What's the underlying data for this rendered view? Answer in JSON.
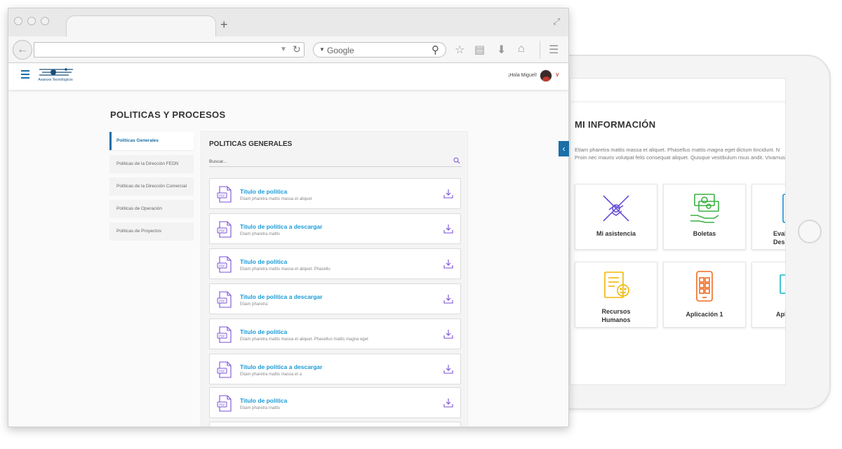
{
  "browser": {
    "new_tab_symbol": "+",
    "search_engine_label": "Google",
    "url_value": ""
  },
  "app": {
    "logo_text": "Avances Tecnológicos",
    "greeting": "¡Hola Miguel!",
    "page_title": "POLITICAS Y PROCESOS",
    "sidebar": {
      "items": [
        {
          "label": "Politicas Generales",
          "active": true
        },
        {
          "label": "Politicas de la Dirección FEDN",
          "active": false
        },
        {
          "label": "Politicas de la Dirección Comercial",
          "active": false
        },
        {
          "label": "Politicas de Operación",
          "active": false
        },
        {
          "label": "Politicas de Proyectos",
          "active": false
        }
      ]
    },
    "panel": {
      "title": "POLITICAS GENERALES",
      "search_placeholder": "Buscar...",
      "documents": [
        {
          "title": "Titulo de politica",
          "subtitle": "Etiam pharetra mattis massa et aliquet"
        },
        {
          "title": "Titulo de politica a descargar",
          "subtitle": "Etiam pharetra mattis"
        },
        {
          "title": "Titulo de politica",
          "subtitle": "Etiam pharetra mattis massa et aliquet. Phasellu"
        },
        {
          "title": "Titulo de politica a descargar",
          "subtitle": "Etiam pharetra"
        },
        {
          "title": "Titulo de politica",
          "subtitle": "Etiam pharetra mattis massa et aliquet. Phasellus mattis magna eget"
        },
        {
          "title": "Titulo de politica a descargar",
          "subtitle": "Etiam pharetra mattis massa et a"
        },
        {
          "title": "Titulo de politica",
          "subtitle": "Etiam pharetra mattis"
        }
      ]
    }
  },
  "tablet": {
    "title": "MI INFORMACIÓN",
    "description_line1": "Etiam pharetra mattis massa et aliquet. Phasellus mattis magna eget dictum tincidunt. N",
    "description_line2": "Proin nec mauris volutpat felis consequat aliquet. Quisque vestibulum risus andit. Vivamus",
    "cards": [
      {
        "label": "Mi asistencia",
        "icon": "handshake-icon",
        "color": "#6b4fd8"
      },
      {
        "label": "Boletas",
        "icon": "money-hand-icon",
        "color": "#3cb043"
      },
      {
        "label": "Evalu\nDes",
        "icon": "checklist-icon",
        "color": "#1a8fd8"
      },
      {
        "label": "Recursos\nHumanos",
        "icon": "document-smile-icon",
        "color": "#f2b705"
      },
      {
        "label": "Aplicación 1",
        "icon": "mobile-grid-icon",
        "color": "#f26a21"
      },
      {
        "label": "Apl",
        "icon": "monitor-check-icon",
        "color": "#13b5cf"
      }
    ]
  },
  "colors": {
    "brand_blue": "#1a6fa8",
    "link_blue": "#1a9bd7",
    "pdf_purple": "#7b4fd8",
    "accent_red": "#c0392b"
  }
}
